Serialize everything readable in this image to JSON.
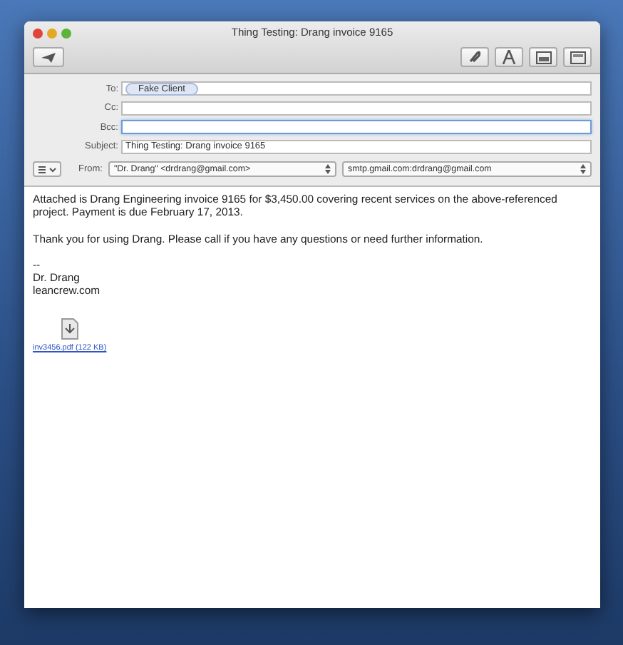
{
  "window": {
    "title": "Thing Testing: Drang invoice 9165"
  },
  "header": {
    "to": {
      "label": "To:",
      "recipients": [
        "Fake Client"
      ]
    },
    "cc": {
      "label": "Cc:",
      "focused": false
    },
    "bcc": {
      "label": "Bcc:",
      "focused": true
    },
    "subject": {
      "label": "Subject:",
      "value": "Thing Testing: Drang invoice 9165"
    },
    "from": {
      "label": "From:",
      "account": "\"Dr. Drang\" <drdrang@gmail.com>",
      "server": "smtp.gmail.com:drdrang@gmail.com"
    }
  },
  "body": {
    "paragraphs": [
      "Attached is Drang Engineering invoice 9165 for $3,450.00 covering recent services on the above-referenced project. Payment is due February 17, 2013.",
      "Thank you for using Drang. Please call if you have any questions or need further information."
    ],
    "signature": [
      "--",
      "Dr. Drang",
      "leancrew.com"
    ],
    "attachment": {
      "name": "inv3456.pdf (122 KB)"
    }
  }
}
